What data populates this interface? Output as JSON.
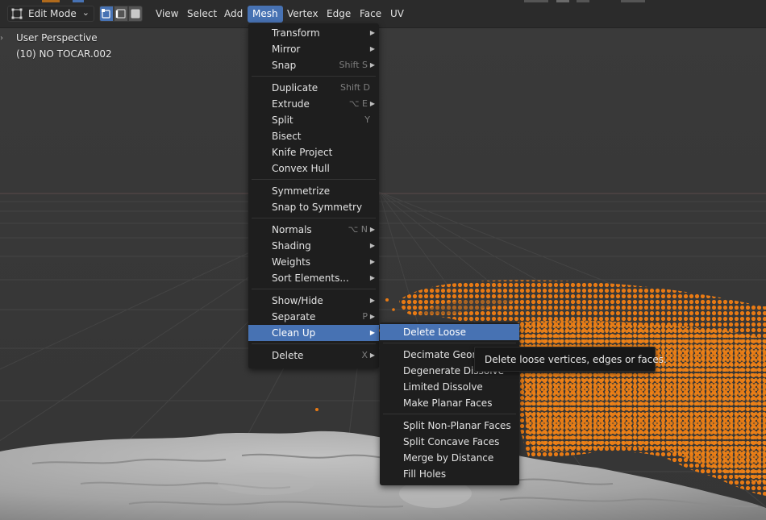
{
  "header": {
    "mode_label": "Edit Mode",
    "menus": [
      "View",
      "Select",
      "Add",
      "Mesh",
      "Vertex",
      "Edge",
      "Face",
      "UV"
    ],
    "open_menu": "Mesh",
    "select_modes": [
      "vertex-select-icon",
      "edge-select-icon",
      "face-select-icon"
    ],
    "active_select_mode": "vertex"
  },
  "viewport": {
    "view_name": "User Perspective",
    "object_name": "(10) NO TOCAR.002",
    "point_color": "#e87a14",
    "mesh_color": "#a6a6a6",
    "grid_color": "#444444"
  },
  "mesh_menu": {
    "items": [
      {
        "label": "Transform",
        "shortcut": "",
        "submenu": true
      },
      {
        "label": "Mirror",
        "shortcut": "",
        "submenu": true
      },
      {
        "label": "Snap",
        "shortcut": "Shift S",
        "submenu": true
      },
      {
        "label": "Duplicate",
        "shortcut": "Shift D",
        "submenu": false
      },
      {
        "label": "Extrude",
        "shortcut": "⌥ E",
        "submenu": true
      },
      {
        "label": "Split",
        "shortcut": "Y",
        "submenu": false
      },
      {
        "label": "Bisect",
        "shortcut": "",
        "submenu": false
      },
      {
        "label": "Knife Project",
        "shortcut": "",
        "submenu": false
      },
      {
        "label": "Convex Hull",
        "shortcut": "",
        "submenu": false
      },
      {
        "label": "Symmetrize",
        "shortcut": "",
        "submenu": false
      },
      {
        "label": "Snap to Symmetry",
        "shortcut": "",
        "submenu": false
      },
      {
        "label": "Normals",
        "shortcut": "⌥ N",
        "submenu": true
      },
      {
        "label": "Shading",
        "shortcut": "",
        "submenu": true
      },
      {
        "label": "Weights",
        "shortcut": "",
        "submenu": true
      },
      {
        "label": "Sort Elements...",
        "shortcut": "",
        "submenu": true
      },
      {
        "label": "Show/Hide",
        "shortcut": "",
        "submenu": true
      },
      {
        "label": "Separate",
        "shortcut": "P",
        "submenu": true
      },
      {
        "label": "Clean Up",
        "shortcut": "",
        "submenu": true,
        "highlighted": true
      },
      {
        "label": "Delete",
        "shortcut": "X",
        "submenu": true
      }
    ]
  },
  "cleanup_menu": {
    "items": [
      {
        "label": "Delete Loose",
        "highlighted": true
      },
      {
        "label": "Decimate Geometry"
      },
      {
        "label": "Degenerate Dissolve"
      },
      {
        "label": "Limited Dissolve"
      },
      {
        "label": "Make Planar Faces"
      },
      {
        "label": "Split Non-Planar Faces"
      },
      {
        "label": "Split Concave Faces"
      },
      {
        "label": "Merge by Distance"
      },
      {
        "label": "Fill Holes"
      }
    ]
  },
  "tooltip": {
    "text": "Delete loose vertices, edges or faces."
  },
  "colors": {
    "accent": "#4772b3",
    "menu_bg": "#1e1e1e",
    "header_bg": "#2b2b2b"
  }
}
